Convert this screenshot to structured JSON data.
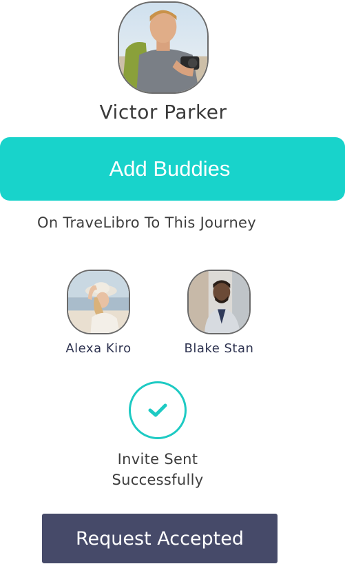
{
  "profile": {
    "name": "Victor Parker",
    "avatar_icon": "profile-photo"
  },
  "add_buddies": {
    "label": "Add Buddies",
    "color": "#18d3cb"
  },
  "subtitle": "On TraveLibro To This Journey",
  "buddies": [
    {
      "name": "Alexa Kiro",
      "avatar_icon": "profile-photo"
    },
    {
      "name": "Blake Stan",
      "avatar_icon": "profile-photo"
    }
  ],
  "invite_status": {
    "line1": "Invite Sent",
    "line2": "Successfully",
    "icon": "check-icon",
    "color": "#1dcac3"
  },
  "request_button": {
    "label": "Request Accepted",
    "color": "#464a69"
  }
}
